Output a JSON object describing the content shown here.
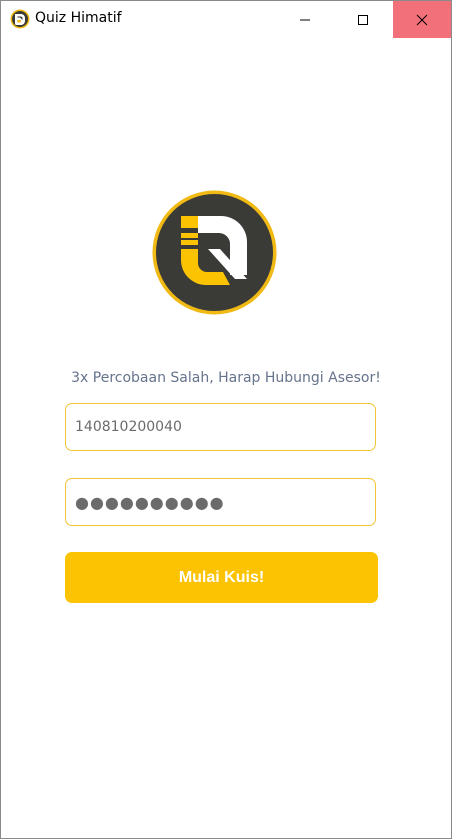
{
  "window": {
    "title": "Quiz Himatif",
    "icon": "app-logo-icon",
    "controls": [
      "minimize-icon",
      "maximize-icon",
      "close-icon"
    ]
  },
  "login": {
    "logo": "quiz-logo",
    "notice": "3x Percobaan Salah, Harap Hubungi Asesor!",
    "username_value": "140810200040",
    "password_value": "●●●●●●●●●●",
    "submit_label": "Mulai Kuis!"
  },
  "colors": {
    "accent": "#FBC302",
    "field_border": "#F2C43A",
    "notice_text": "#66738C",
    "logo_dark": "#3A3A36",
    "close_hover": "#F1707A"
  }
}
